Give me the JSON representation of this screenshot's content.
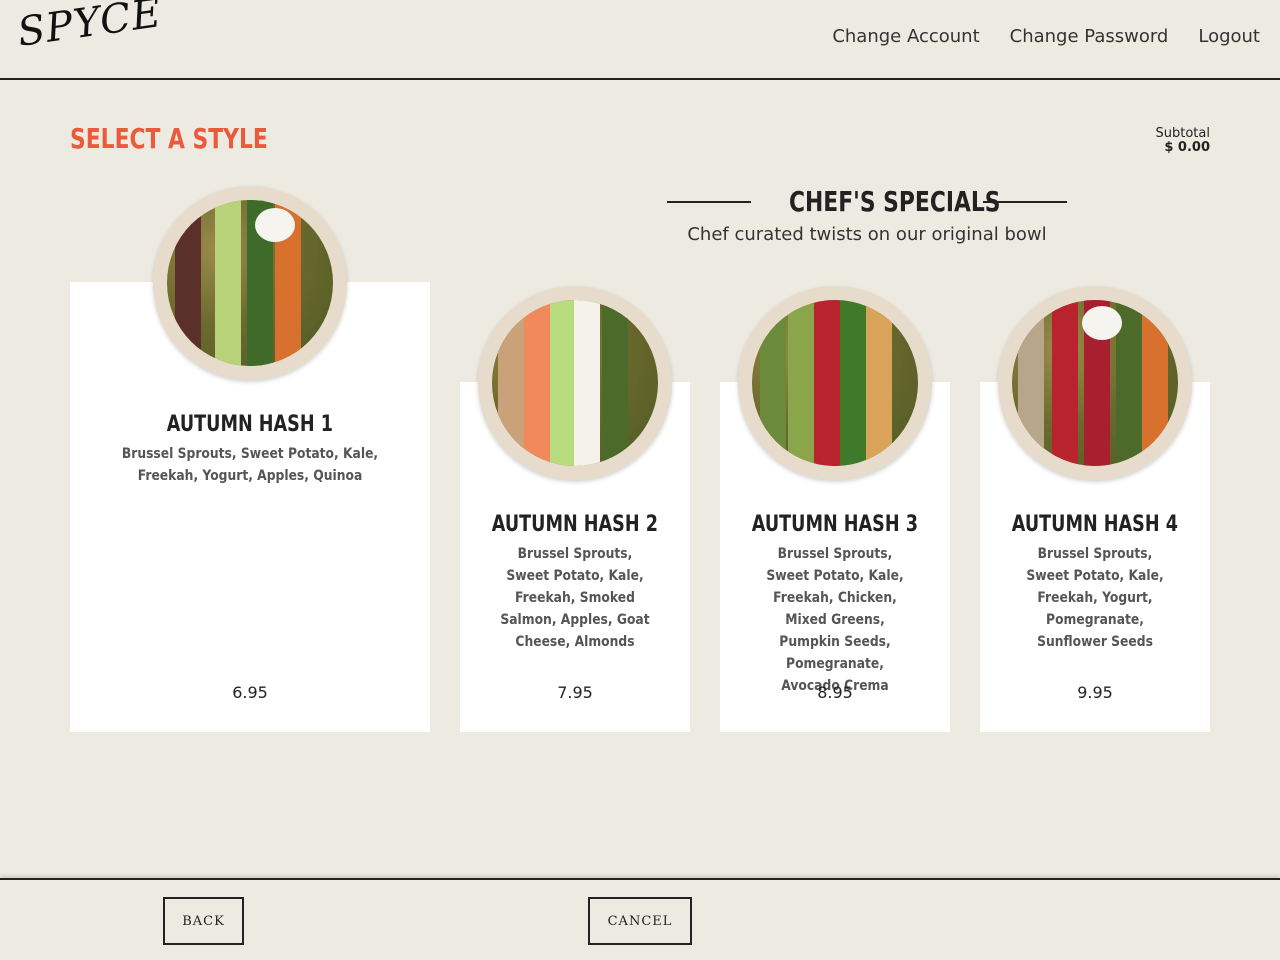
{
  "header": {
    "logo": "SPYCE",
    "nav": [
      "Change Account",
      "Change Password",
      "Logout"
    ]
  },
  "main": {
    "title": "SELECT A STYLE",
    "subtotal_label": "Subtotal",
    "subtotal_value": "$ 0.00",
    "specials_title": "CHEF'S SPECIALS",
    "specials_subtitle": "Chef curated twists on our original bowl"
  },
  "cards": [
    {
      "name": "AUTUMN HASH 1",
      "desc": "Brussel Sprouts, Sweet Potato, Kale, Freekah, Yogurt, Apples, Quinoa",
      "price": "6.95"
    },
    {
      "name": "AUTUMN HASH 2",
      "desc": "Brussel Sprouts, Sweet Potato, Kale, Freekah, Smoked Salmon, Apples, Goat Cheese, Almonds",
      "price": "7.95"
    },
    {
      "name": "AUTUMN HASH 3",
      "desc": "Brussel Sprouts, Sweet Potato, Kale, Freekah, Chicken, Mixed Greens, Pumpkin Seeds, Pomegranate, Avocado Crema",
      "price": "8.95"
    },
    {
      "name": "AUTUMN HASH 4",
      "desc": "Brussel Sprouts, Sweet Potato, Kale, Freekah, Yogurt, Pomegranate, Sunflower Seeds",
      "price": "9.95"
    }
  ],
  "footer": {
    "back_label": "BACK",
    "cancel_label": "CANCEL"
  },
  "colors": {
    "accent": "#ec5a3c",
    "background": "#edebe1"
  }
}
